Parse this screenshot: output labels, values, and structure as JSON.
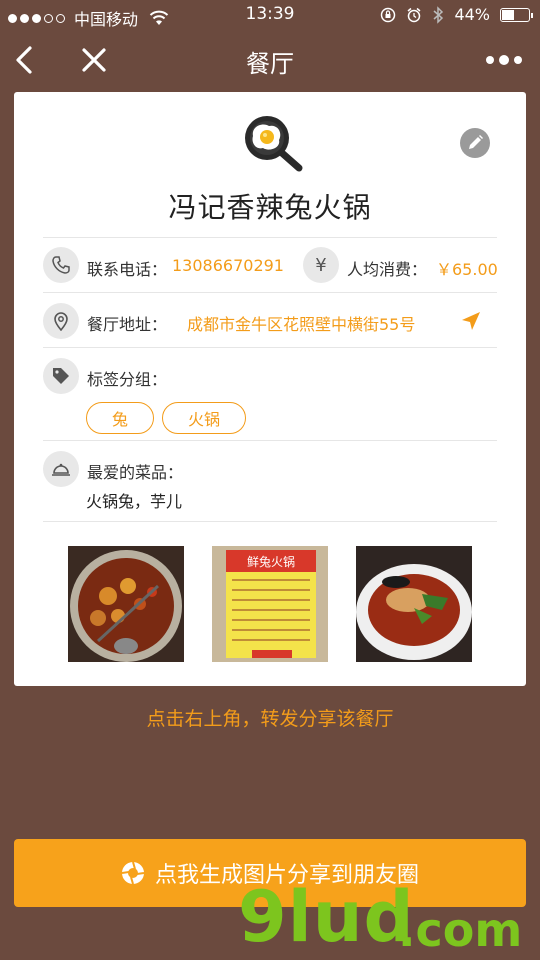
{
  "status_bar": {
    "carrier": "中国移动",
    "time": "13:39",
    "battery_text": "44%",
    "battery_level": 0.44
  },
  "nav": {
    "title": "餐厅"
  },
  "restaurant": {
    "name": "冯记香辣兔火锅",
    "phone_label": "联系电话：",
    "phone": "13086670291",
    "avg_label": "人均消费：",
    "avg_value": "￥65.00",
    "address_label": "餐厅地址：",
    "address": "成都市金牛区花照壁中横街55号",
    "tags_label": "标签分组：",
    "tags": [
      "兔",
      "火锅"
    ],
    "fav_label": "最爱的菜品：",
    "fav_dishes": "火锅兔，芋儿",
    "menu_photo_title": "鲜兔火锅"
  },
  "share_hint": "点击右上角，转发分享该餐厅",
  "generate_button": "点我生成图片分享到朋友圈",
  "watermark": {
    "main": "9lud",
    "suffix": ".com"
  },
  "colors": {
    "accent": "#f39c1a",
    "background": "#6b4a3e"
  }
}
